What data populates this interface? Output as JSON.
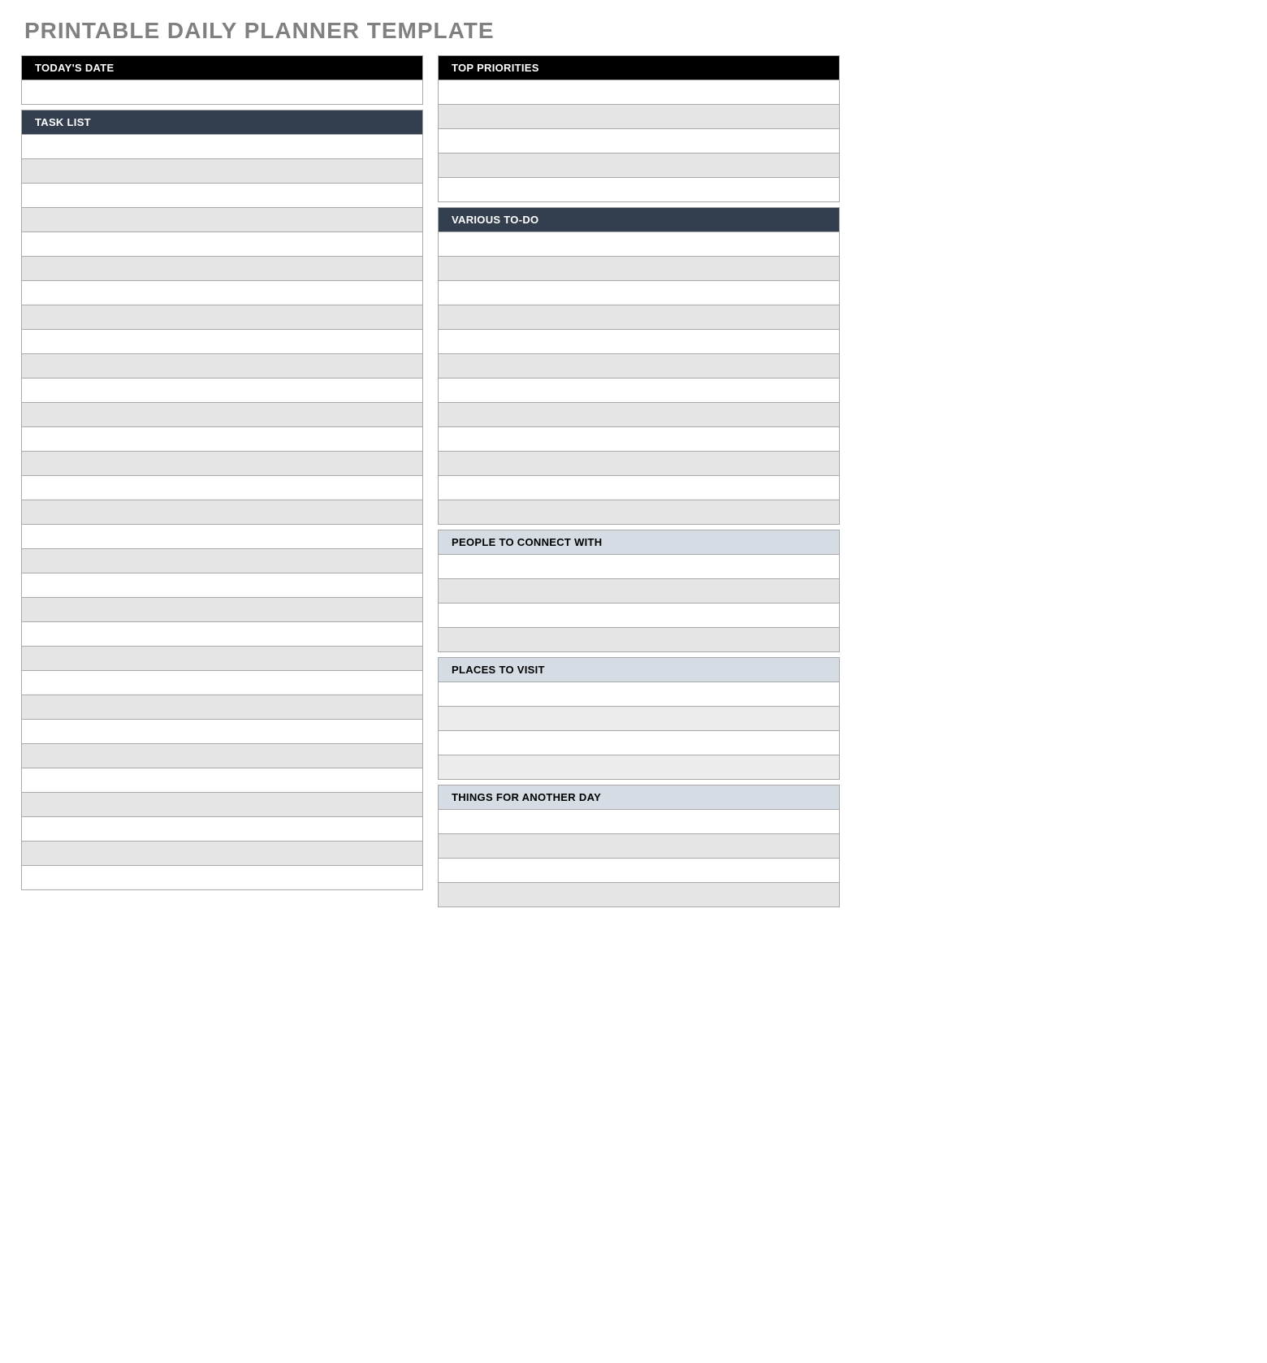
{
  "page_title": "PRINTABLE DAILY PLANNER TEMPLATE",
  "left": {
    "todays_date": {
      "label": "TODAY'S DATE",
      "rows": 1
    },
    "task_list": {
      "label": "TASK LIST",
      "rows": 31
    }
  },
  "right": {
    "top_priorities": {
      "label": "TOP PRIORITIES",
      "rows": 5
    },
    "various_todo": {
      "label": "VARIOUS TO-DO",
      "rows": 12
    },
    "people_to_connect": {
      "label": "PEOPLE TO CONNECT WITH",
      "rows": 4
    },
    "places_to_visit": {
      "label": "PLACES TO VISIT",
      "rows": 4
    },
    "things_another_day": {
      "label": "THINGS FOR ANOTHER DAY",
      "rows": 4
    }
  },
  "colors": {
    "header_black": "#000000",
    "header_navy": "#333f4f",
    "header_blue": "#d5dce4",
    "row_grey": "#e5e5e5",
    "row_lgrey": "#ececec",
    "border": "#a9a9a9",
    "title_grey": "#808080"
  }
}
